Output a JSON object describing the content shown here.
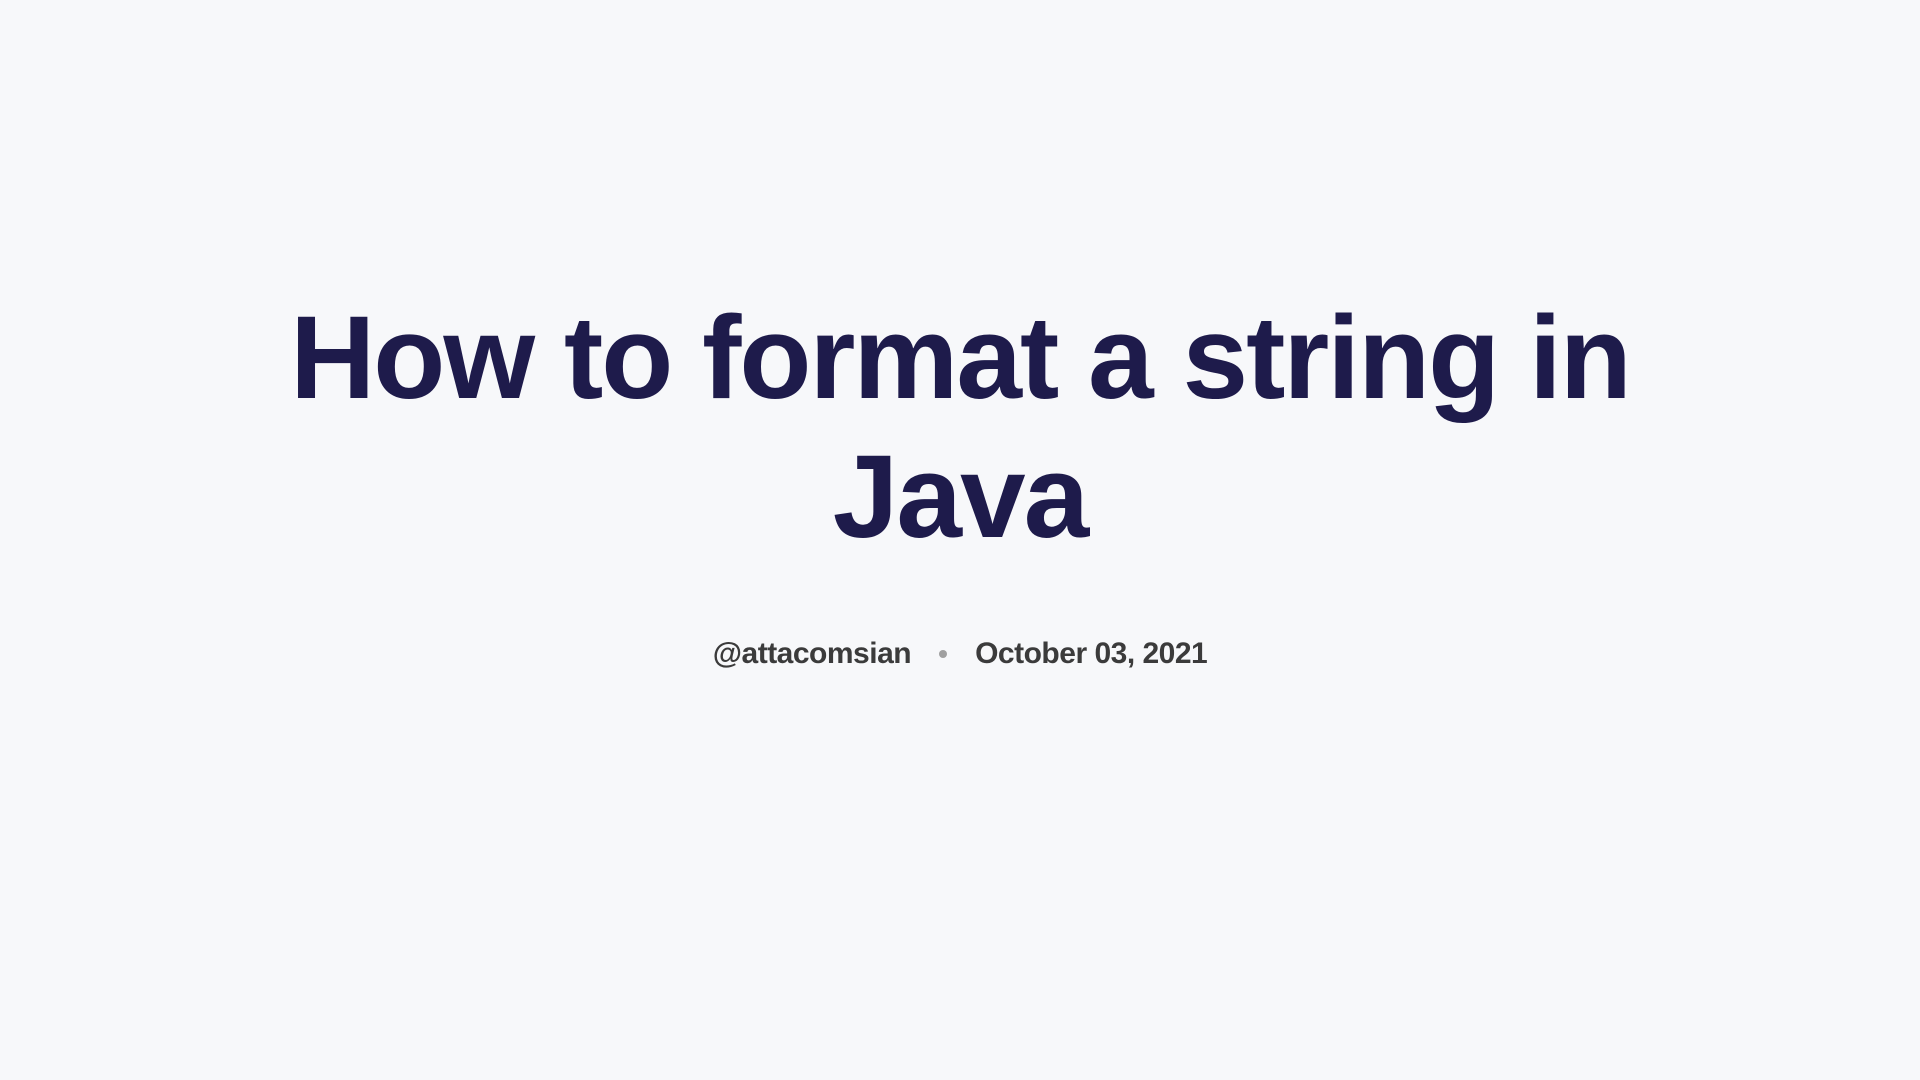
{
  "article": {
    "title": "How to format a string in Java",
    "author": "@attacomsian",
    "date": "October 03, 2021"
  }
}
